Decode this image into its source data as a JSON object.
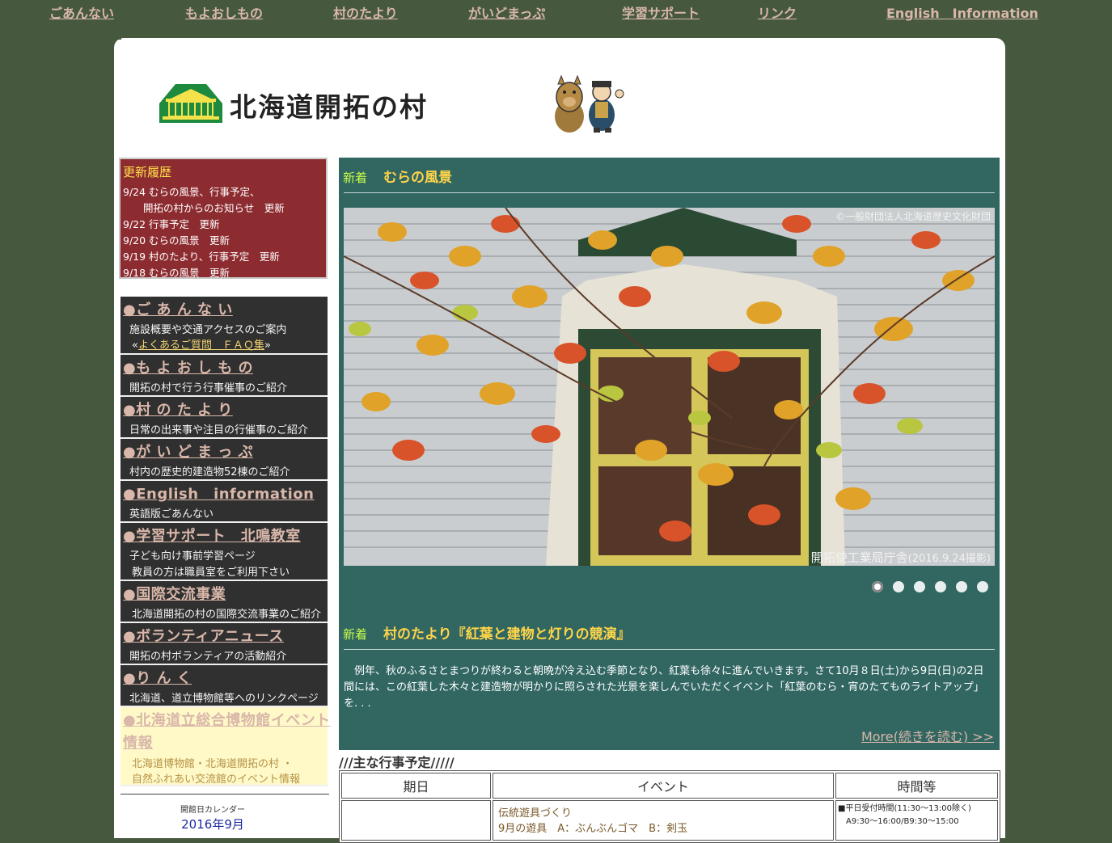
{
  "topnav": [
    {
      "label": "ごあんない"
    },
    {
      "label": "もよおしもの"
    },
    {
      "label": "村のたより"
    },
    {
      "label": "がいどまっぷ"
    },
    {
      "label": "学習サポート"
    },
    {
      "label": "リンク"
    },
    {
      "label": "English　Information"
    }
  ],
  "header": {
    "title": "北海道開拓の村"
  },
  "updates": {
    "title": "更新履歴",
    "items": [
      "9/24 むらの風景、行事予定、",
      "　　開拓の村からのお知らせ　更新",
      "9/22 行事予定　更新",
      "9/20 むらの風景　更新",
      "9/19 村のたより、行事予定　更新",
      "9/18 むらの風景　更新"
    ]
  },
  "sidenav": [
    {
      "title": "●ご あ ん な い",
      "desc": "施設概要や交通アクセスのご案内",
      "extra_prefix": "«",
      "extra_link": "よくあるご質問　ＦＡＱ集",
      "extra_suffix": "»"
    },
    {
      "title": "●も よ お し も の",
      "desc": "開拓の村で行う行事催事のご紹介"
    },
    {
      "title": "●村 の た よ り",
      "desc": "日常の出来事や注目の行催事のご紹介"
    },
    {
      "title": "●が い ど ま っ ぷ",
      "desc": "村内の歴史的建造物52棟のご紹介"
    },
    {
      "title": "●English　information",
      "desc": "英語版ごあんない"
    },
    {
      "title": "●学習サポート　北鳴教室",
      "desc": "子ども向け事前学習ページ",
      "desc2": "教員の方は職員室をご利用下さい"
    },
    {
      "title": "●国際交流事業",
      "desc": "北海道開拓の村の国際交流事業のご紹介"
    },
    {
      "title": "●ボランティアニュース",
      "desc": "開拓の村ボランティアの活動紹介"
    },
    {
      "title": "●り ん く",
      "desc": "北海道、道立博物館等へのリンクページ"
    },
    {
      "title": "●北海道立総合博物館イベント",
      "title2": "情報",
      "desc": "北海道博物館・北海道開拓の村 ・",
      "desc2": "自然ふれあい交流館のイベント情報"
    }
  ],
  "calendar": {
    "title": "開館日カレンダー",
    "month": "2016年9月"
  },
  "news": {
    "new_label": "新着",
    "heading1": "むらの風景",
    "photo_copyright": "©一般財団法人北海道歴史文化財団",
    "photo_caption": "開拓使工業局庁舎",
    "photo_caption_date": "(2016.9.24撮影)",
    "heading2": "村のたより『紅葉と建物と灯りの競演』",
    "body_line1": "　例年、秋のふるさとまつりが終わると朝晩が冷え込む季節となり、紅葉も徐々に進んでいきます。さて10月８日(土)から9日(日)の2日",
    "body_line2": "間には、この紅葉した木々と建造物が明かりに照らされた光景を楽しんでいただくイベント「紅葉のむら・宵のたてものライトアップ」",
    "body_line3": "を. . .",
    "more": "More(続きを読む) >>",
    "slides": 6,
    "active_slide": 1
  },
  "schedule": {
    "title": "///主な行事予定/////",
    "headers": [
      "期日",
      "イベント",
      "時間等"
    ],
    "row1_event": "伝統遊具づくり",
    "row1_event2": "9月の遊具　A：ぶんぶんゴマ　B：剣玉",
    "row1_time": "■平日受付時間(11:30～13:00除く)",
    "row1_time2": "A9:30～16:00/B9:30～15:00"
  },
  "colors": {
    "background": "#46593e",
    "nav_link": "#d9b7aa",
    "updates_bg": "#8d2c30",
    "news_bg": "#316661",
    "news_heading": "#ffd54a",
    "new_label": "#c7ff49"
  }
}
